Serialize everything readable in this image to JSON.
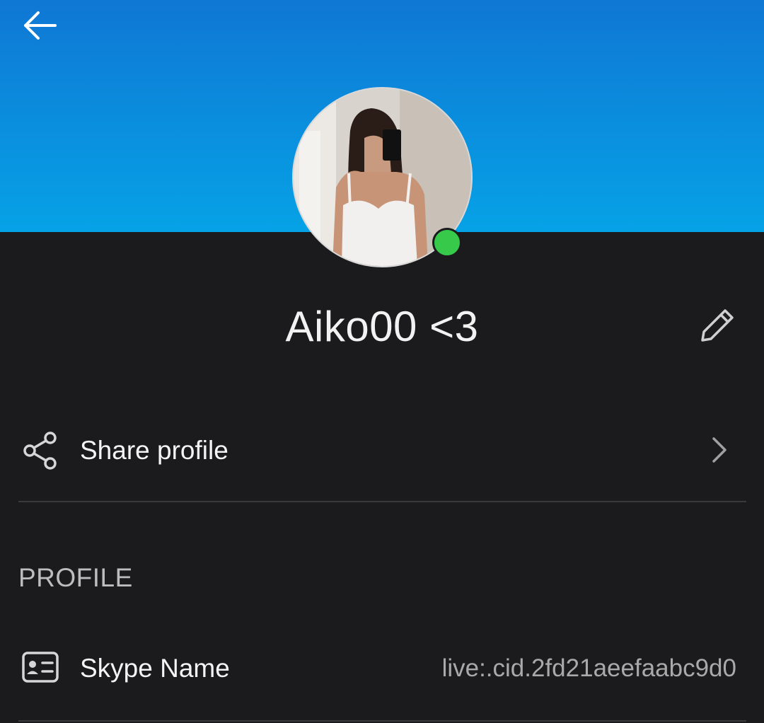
{
  "header": {
    "back_icon": "arrow-left-icon",
    "banner_color_top": "#0f77d4",
    "banner_color_bottom": "#06a2e6"
  },
  "profile": {
    "display_name": "Aiko00 <3",
    "presence": "online",
    "presence_color": "#36c94a",
    "edit_icon": "pencil-icon"
  },
  "actions": {
    "share": {
      "icon": "share-icon",
      "label": "Share profile",
      "chevron_icon": "chevron-right-icon"
    }
  },
  "sections": {
    "profile_header": "PROFILE",
    "fields": [
      {
        "icon": "contact-card-icon",
        "label": "Skype Name",
        "value": "live:.cid.2fd21aeefaabc9d0"
      }
    ]
  }
}
